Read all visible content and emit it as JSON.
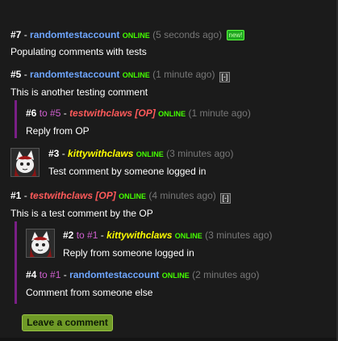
{
  "comments": [
    {
      "number": "#7",
      "dash": " - ",
      "author": "randomtestaccount",
      "status": "ONLINE",
      "time": "(5 seconds ago)",
      "badge": "new!",
      "text": "Populating comments with tests"
    },
    {
      "number": "#5",
      "dash": " - ",
      "author": "randomtestaccount",
      "status": "ONLINE",
      "time": "(1 minute ago)",
      "collapse": "[-]",
      "text": "This is another testing comment"
    },
    {
      "number": "#6",
      "to": " to #5",
      "dash": " - ",
      "author": "testwithclaws [OP]",
      "status": "ONLINE",
      "time": "(1 minute ago)",
      "text": "Reply from OP"
    },
    {
      "number": "#3",
      "dash": " - ",
      "author": "kittywithclaws",
      "status": "ONLINE",
      "time": "(3 minutes ago)",
      "text": "Test comment by someone logged in"
    },
    {
      "number": "#1",
      "dash": " - ",
      "author": "testwithclaws [OP]",
      "status": "ONLINE",
      "time": "(4 minutes ago)",
      "collapse": "[-]",
      "text": "This is a test comment by the OP"
    },
    {
      "number": "#2",
      "to": " to #1",
      "dash": " - ",
      "author": "kittywithclaws",
      "status": "ONLINE",
      "time": "(3 minutes ago)",
      "text": "Reply from someone logged in"
    },
    {
      "number": "#4",
      "to": " to #1",
      "dash": " - ",
      "author": "randomtestaccount",
      "status": "ONLINE",
      "time": "(2 minutes ago)",
      "text": "Comment from someone else"
    }
  ],
  "leave_comment_label": "Leave a comment",
  "colors": {
    "background": "#1b1b1b",
    "author_regular": "#6ea6ff",
    "author_op": "#ff5a5a",
    "author_logged_in": "#ffff00",
    "online": "#44ff00",
    "reply_to": "#d060d0",
    "thread_bar": "#7a1f86",
    "button": "#6f9a27"
  },
  "icons": {
    "avatar": "cat-avatar-icon",
    "collapse": "collapse-icon"
  }
}
